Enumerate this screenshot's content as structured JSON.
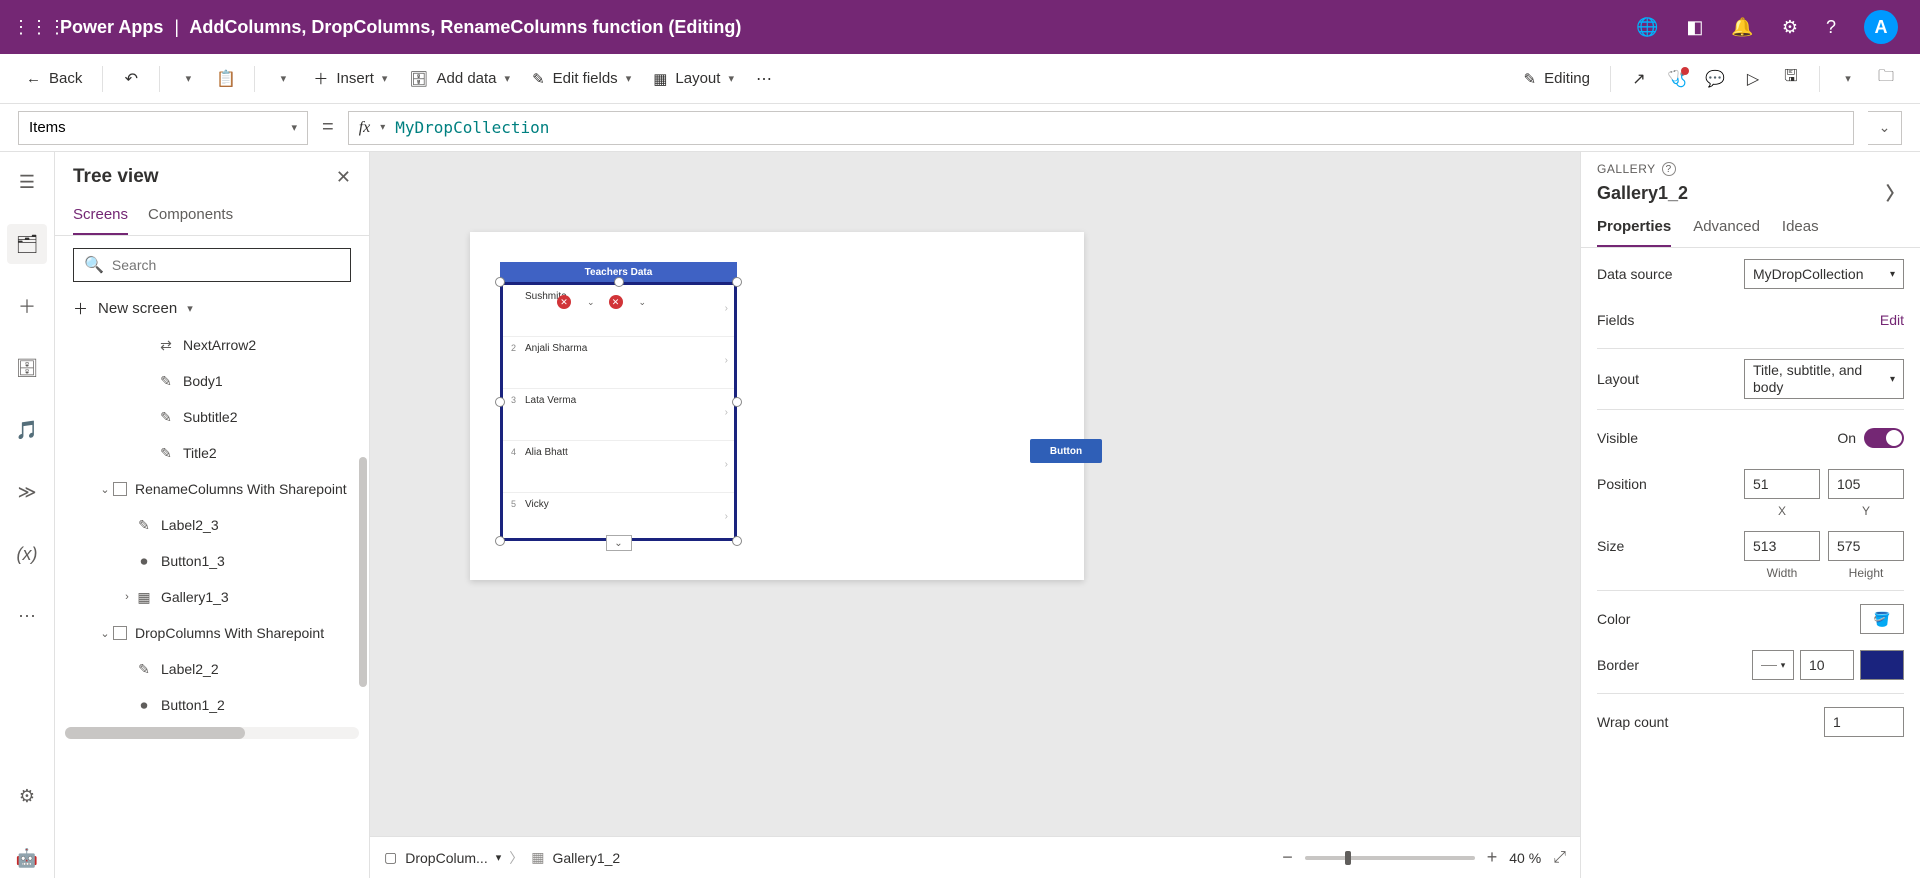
{
  "header": {
    "app_name": "Power Apps",
    "doc_title": "AddColumns, DropColumns, RenameColumns function (Editing)",
    "avatar_initial": "A"
  },
  "cmdbar": {
    "back": "Back",
    "insert": "Insert",
    "add_data": "Add data",
    "edit_fields": "Edit fields",
    "layout": "Layout",
    "editing": "Editing"
  },
  "formula": {
    "property": "Items",
    "value": "MyDropCollection"
  },
  "tree": {
    "title": "Tree view",
    "tab_screens": "Screens",
    "tab_components": "Components",
    "search_placeholder": "Search",
    "new_screen": "New screen",
    "nodes": [
      {
        "indent": 3,
        "icon": "arrow2",
        "label": "NextArrow2"
      },
      {
        "indent": 3,
        "icon": "ctrl",
        "label": "Body1"
      },
      {
        "indent": 3,
        "icon": "ctrl",
        "label": "Subtitle2"
      },
      {
        "indent": 3,
        "icon": "ctrl",
        "label": "Title2"
      },
      {
        "indent": 1,
        "twisty": "v",
        "icon": "screen",
        "label": "RenameColumns With Sharepoint"
      },
      {
        "indent": 2,
        "icon": "ctrl",
        "label": "Label2_3"
      },
      {
        "indent": 2,
        "icon": "button",
        "label": "Button1_3"
      },
      {
        "indent": 2,
        "twisty": ">",
        "icon": "gallery",
        "label": "Gallery1_3"
      },
      {
        "indent": 1,
        "twisty": "v",
        "icon": "screen",
        "label": "DropColumns With Sharepoint"
      },
      {
        "indent": 2,
        "icon": "ctrl",
        "label": "Label2_2"
      },
      {
        "indent": 2,
        "icon": "button",
        "label": "Button1_2"
      }
    ]
  },
  "canvas": {
    "gallery_header": "Teachers Data",
    "rows": [
      {
        "n": "",
        "name": "Sushmita"
      },
      {
        "n": "2",
        "name": "Anjali Sharma"
      },
      {
        "n": "3",
        "name": "Lata Verma"
      },
      {
        "n": "4",
        "name": "Alia Bhatt"
      },
      {
        "n": "5",
        "name": "Vicky"
      }
    ],
    "button_text": "Button",
    "breadcrumb_screen": "DropColum...",
    "breadcrumb_ctrl": "Gallery1_2",
    "zoom": "40  %"
  },
  "props": {
    "type_label": "GALLERY",
    "name": "Gallery1_2",
    "tab_properties": "Properties",
    "tab_advanced": "Advanced",
    "tab_ideas": "Ideas",
    "data_source_label": "Data source",
    "data_source_value": "MyDropCollection",
    "fields_label": "Fields",
    "fields_edit": "Edit",
    "layout_label": "Layout",
    "layout_value": "Title, subtitle, and body",
    "visible_label": "Visible",
    "visible_value": "On",
    "position_label": "Position",
    "pos_x": "51",
    "pos_y": "105",
    "pos_x_sub": "X",
    "pos_y_sub": "Y",
    "size_label": "Size",
    "size_w": "513",
    "size_h": "575",
    "size_w_sub": "Width",
    "size_h_sub": "Height",
    "color_label": "Color",
    "border_label": "Border",
    "border_width": "10",
    "wrap_label": "Wrap count",
    "wrap_value": "1"
  }
}
